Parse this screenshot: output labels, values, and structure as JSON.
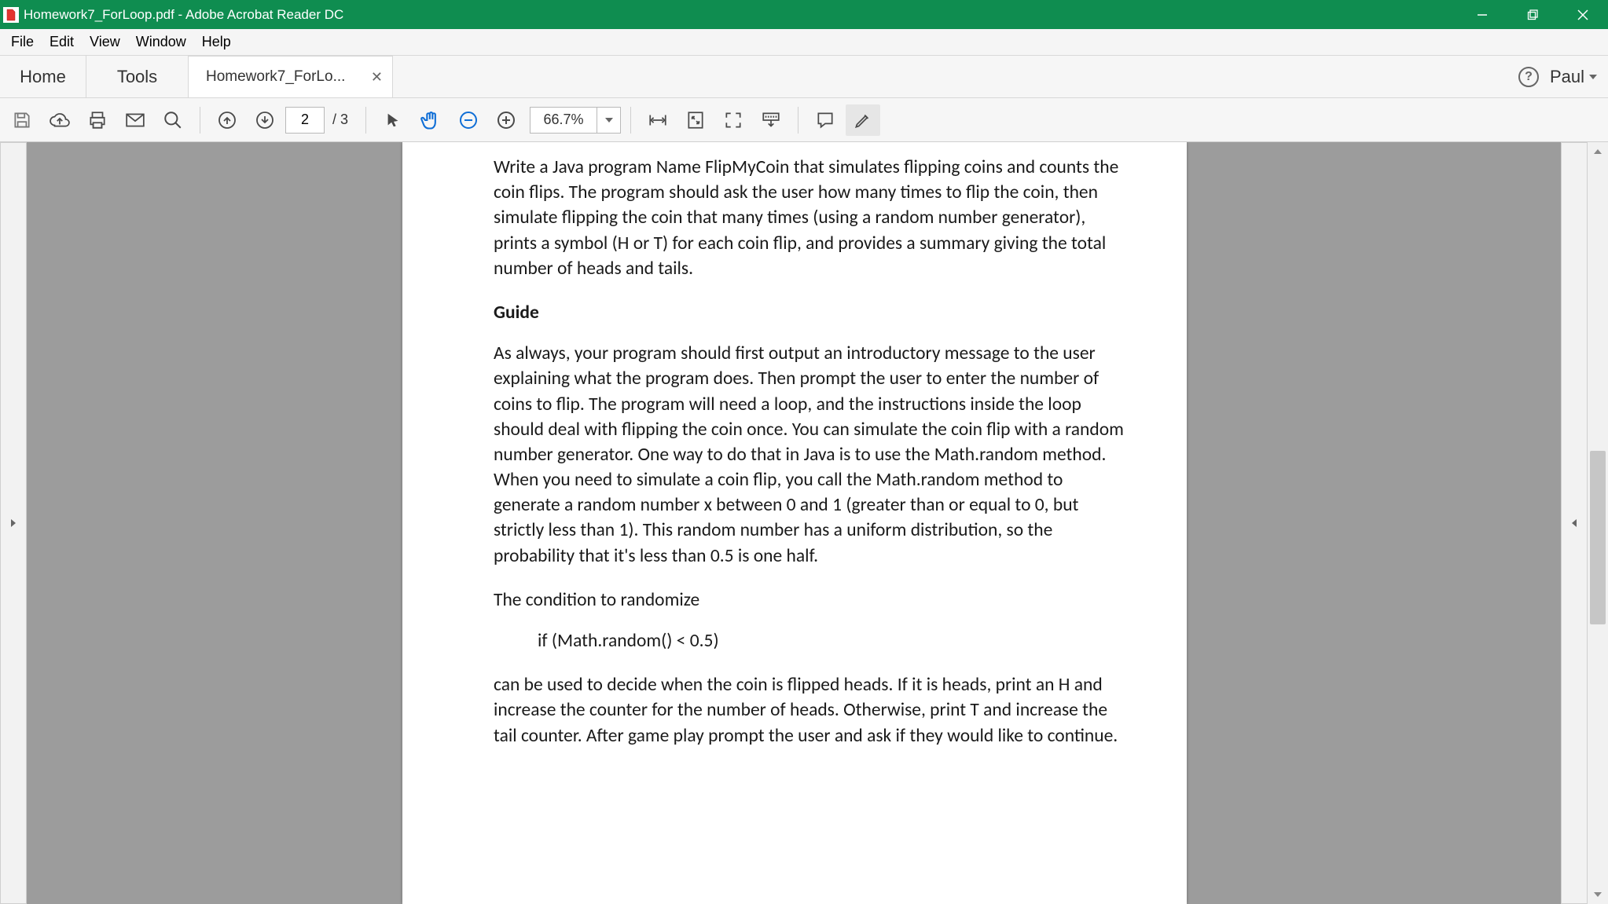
{
  "window": {
    "title": "Homework7_ForLoop.pdf - Adobe Acrobat Reader DC"
  },
  "menu": {
    "file": "File",
    "edit": "Edit",
    "view": "View",
    "window": "Window",
    "help": "Help"
  },
  "tabs": {
    "home": "Home",
    "tools": "Tools",
    "doc_label": "Homework7_ForLo..."
  },
  "user": {
    "name": "Paul"
  },
  "toolbar": {
    "page_current": "2",
    "page_total": "/ 3",
    "zoom_value": "66.7%"
  },
  "doc": {
    "p1": "Write a Java program Name FlipMyCoin that simulates flipping coins and counts the coin flips. The program should ask the user how many times to flip the coin, then simulate flipping the coin that many times (using a random number generator), prints a symbol (H or T) for each coin flip, and provides a summary giving the total number of heads and tails.",
    "h1": "Guide",
    "p2": "As always, your program should first output an introductory message to the user explaining what the program does. Then prompt the user to enter the number of coins to flip. The program will need a loop, and the instructions inside the loop should deal with flipping the coin once. You can simulate the coin flip with a random number generator. One way to do that in Java is to use the Math.random method. When you need to simulate a coin flip, you call the Math.random method to generate a random number x between 0 and 1 (greater than or equal to 0, but strictly less than 1). This random number has a uniform distribution, so the probability that it's less than 0.5 is one half.",
    "p3": "The condition to randomize",
    "code1": "if (Math.random() < 0.5)",
    "p4": "can be used to decide when the coin is flipped heads. If it is heads, print an H and increase the counter for the number of heads. Otherwise, print T and increase the tail counter. After game play prompt the user and ask if they would like to continue."
  }
}
